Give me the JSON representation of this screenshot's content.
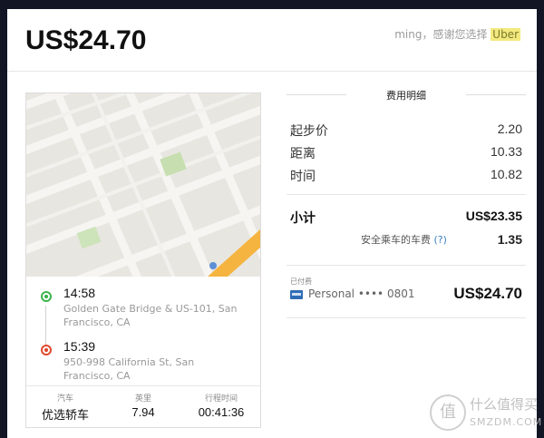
{
  "header": {
    "total": "US$24.70",
    "thanks_text": "ming，感谢您选择",
    "brand": "Uber"
  },
  "trip": {
    "pickup": {
      "time": "14:58",
      "address": "Golden Gate Bridge & US-101, San Francisco, CA"
    },
    "dropoff": {
      "time": "15:39",
      "address": "950-998 California St, San Francisco, CA"
    },
    "stats": [
      {
        "label": "汽车",
        "value": "优选轿车"
      },
      {
        "label": "英里",
        "value": "7.94"
      },
      {
        "label": "行程时间",
        "value": "00:41:36"
      }
    ]
  },
  "fare": {
    "title": "费用明细",
    "items": [
      {
        "label": "起步价",
        "value": "2.20"
      },
      {
        "label": "距离",
        "value": "10.33"
      },
      {
        "label": "时间",
        "value": "10.82"
      }
    ],
    "subtotal": {
      "label": "小计",
      "value": "US$23.35"
    },
    "safety_fee": {
      "label": "安全乘车的车费",
      "help": "(?)",
      "value": "1.35"
    },
    "paid": {
      "label": "已付费",
      "method": "Personal •••• 0801",
      "total": "US$24.70"
    }
  },
  "watermark": {
    "glyph": "值",
    "cn": "什么值得买",
    "en": "SMZDM.COM"
  },
  "colors": {
    "pickup_dot": "#3fb34f",
    "dropoff_dot": "#e04a2e",
    "brand_highlight": "#f3e97f",
    "background": "#121624"
  }
}
